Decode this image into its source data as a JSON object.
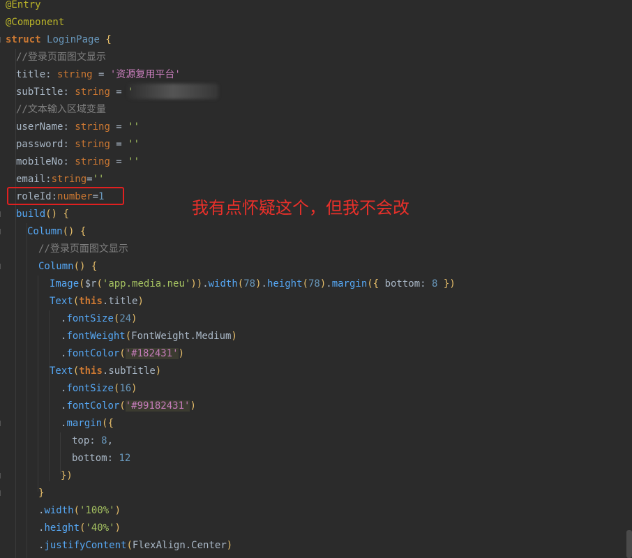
{
  "code": {
    "l1": "@Entry",
    "l2": "@Component",
    "l3_kw": "struct",
    "l3_name": "LoginPage",
    "l3_brace": "{",
    "l4": "//登录页面图文显示",
    "l5_field": "title",
    "l5_type": "string",
    "l5_val": "'资源复用平台'",
    "l6_field": "subTitle",
    "l6_type": "string",
    "l6_val": "'",
    "l7": "//文本输入区域变量",
    "l8_field": "userName",
    "l8_type": "string",
    "l8_val": "''",
    "l9_field": "password",
    "l9_type": "string",
    "l9_val": "''",
    "l10_field": "mobileNo",
    "l10_type": "string",
    "l10_val": "''",
    "l11_field": "email",
    "l11_type": "string",
    "l11_val": "''",
    "l12_field": "roleId",
    "l12_type": "number",
    "l12_val": "1",
    "l13_fn": "build",
    "l14_fn": "Column",
    "l15": "//登录页面图文显示",
    "l16_fn": "Column",
    "l17_img": "Image",
    "l17_res": "$r",
    "l17_arg": "'app.media.neu'",
    "l17_width": "width",
    "l17_w": "78",
    "l17_height": "height",
    "l17_h": "78",
    "l17_margin": "margin",
    "l17_bottom": "bottom",
    "l17_b": "8",
    "l18_fn": "Text",
    "l18_this": "this",
    "l18_prop": "title",
    "l19_fn": "fontSize",
    "l19_v": "24",
    "l20_fn": "fontWeight",
    "l20_v": "FontWeight.Medium",
    "l21_fn": "fontColor",
    "l21_v": "'#182431'",
    "l22_fn": "Text",
    "l22_this": "this",
    "l22_prop": "subTitle",
    "l23_fn": "fontSize",
    "l23_v": "16",
    "l24_fn": "fontColor",
    "l24_v": "'#99182431'",
    "l25_fn": "margin",
    "l26_k": "top",
    "l26_v": "8",
    "l27_k": "bottom",
    "l27_v": "12",
    "l28": "})",
    "l29": "}",
    "l30_fn": "width",
    "l30_v": "'100%'",
    "l31_fn": "height",
    "l31_v": "'40%'",
    "l32_fn": "justifyContent",
    "l32_v": "FlexAlign.Center"
  },
  "annotation": {
    "text": "我有点怀疑这个，但我不会改"
  }
}
